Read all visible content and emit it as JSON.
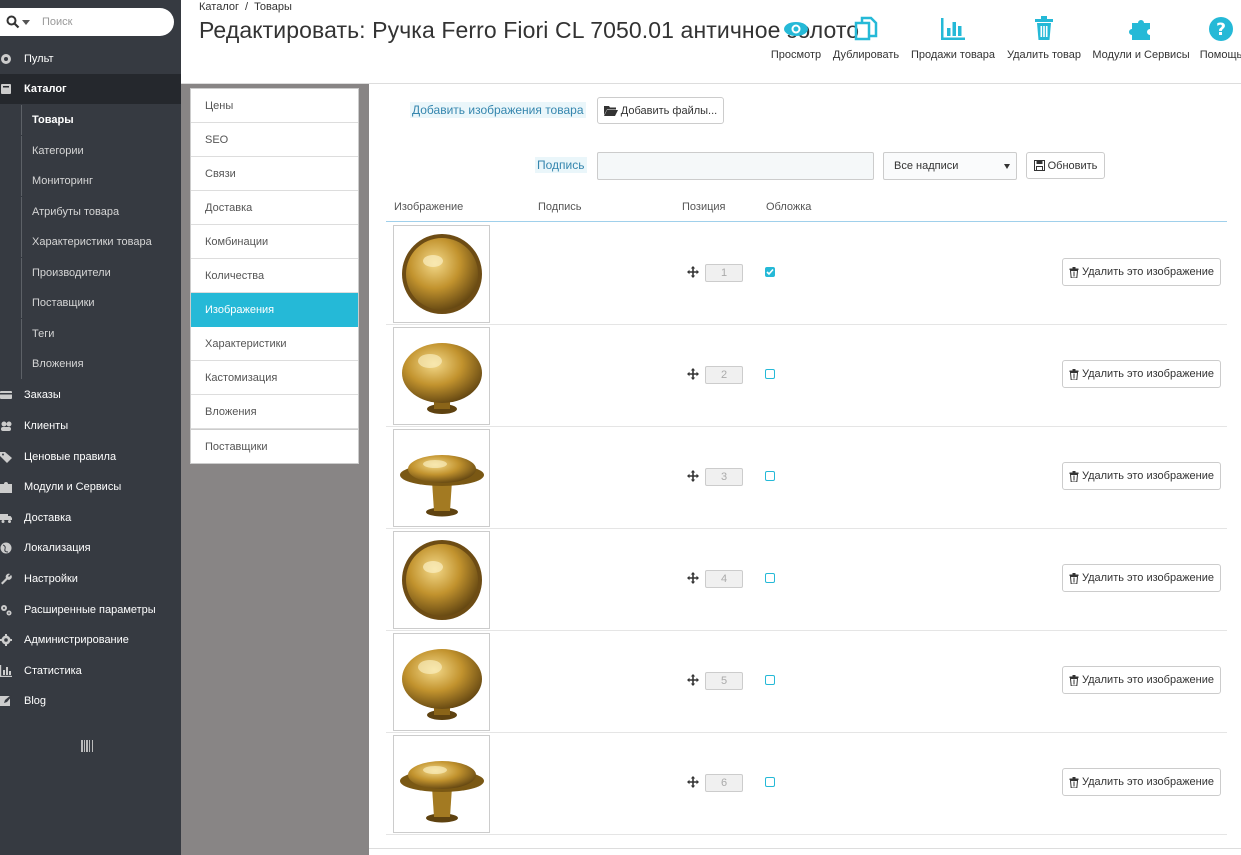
{
  "search": {
    "placeholder": "Поиск"
  },
  "sidebar": {
    "items": [
      {
        "label": "Пульт",
        "icon": "dashboard-icon"
      },
      {
        "label": "Каталог",
        "icon": "catalog-icon",
        "active": true
      },
      {
        "label": "Заказы",
        "icon": "orders-icon"
      },
      {
        "label": "Клиенты",
        "icon": "customers-icon"
      },
      {
        "label": "Ценовые правила",
        "icon": "tag-icon"
      },
      {
        "label": "Модули и Сервисы",
        "icon": "puzzle-icon"
      },
      {
        "label": "Доставка",
        "icon": "truck-icon"
      },
      {
        "label": "Локализация",
        "icon": "globe-icon"
      },
      {
        "label": "Настройки",
        "icon": "wrench-icon"
      },
      {
        "label": "Расширенные параметры",
        "icon": "cogs-icon"
      },
      {
        "label": "Администрирование",
        "icon": "gear-icon"
      },
      {
        "label": "Статистика",
        "icon": "bar-chart-icon"
      },
      {
        "label": "Blog",
        "icon": "edit-icon"
      }
    ],
    "catalog_sub": [
      {
        "label": "Товары",
        "active": true
      },
      {
        "label": "Категории"
      },
      {
        "label": "Мониторинг"
      },
      {
        "label": "Атрибуты товара"
      },
      {
        "label": "Характеристики товара"
      },
      {
        "label": "Производители"
      },
      {
        "label": "Поставщики"
      },
      {
        "label": "Теги"
      },
      {
        "label": "Вложения"
      }
    ]
  },
  "header": {
    "breadcrumb": [
      "Каталог",
      "Товары"
    ],
    "breadcrumb_sep": "/",
    "title": "Редактировать: Ручка Ferro Fiori CL 7050.01 античное золото",
    "toolbar": [
      {
        "label": "Просмотр",
        "icon": "eye-icon"
      },
      {
        "label": "Дублировать",
        "icon": "copy-icon"
      },
      {
        "label": "Продажи товара",
        "icon": "bar-chart-icon"
      },
      {
        "label": "Удалить товар",
        "icon": "trash-icon"
      },
      {
        "label": "Модули и Сервисы",
        "icon": "puzzle-icon"
      },
      {
        "label": "Помощь",
        "icon": "help-icon"
      }
    ],
    "accent_color": "#25b9d7"
  },
  "tabs": [
    {
      "label": "Цены"
    },
    {
      "label": "SEO"
    },
    {
      "label": "Связи"
    },
    {
      "label": "Доставка"
    },
    {
      "label": "Комбинации"
    },
    {
      "label": "Количества"
    },
    {
      "label": "Изображения",
      "active": true
    },
    {
      "label": "Характеристики"
    },
    {
      "label": "Кастомизация"
    },
    {
      "label": "Вложения"
    },
    {
      "label": "Поставщики"
    }
  ],
  "images_panel": {
    "add_images_label": "Добавить изображения товара",
    "add_files_button": "Добавить файлы...",
    "caption_label": "Подпись",
    "caption_value": "",
    "lang_select": "Все надписи",
    "update_button": "Обновить",
    "columns": [
      "Изображение",
      "Подпись",
      "Позиция",
      "Обложка"
    ],
    "rows": [
      {
        "position": "1",
        "cover": true,
        "view": "top",
        "delete_label": "Удалить это изображение"
      },
      {
        "position": "2",
        "cover": false,
        "view": "angle",
        "delete_label": "Удалить это изображение"
      },
      {
        "position": "3",
        "cover": false,
        "view": "side",
        "delete_label": "Удалить это изображение"
      },
      {
        "position": "4",
        "cover": false,
        "view": "top",
        "delete_label": "Удалить это изображение"
      },
      {
        "position": "5",
        "cover": false,
        "view": "angle",
        "delete_label": "Удалить это изображение"
      },
      {
        "position": "6",
        "cover": false,
        "view": "side",
        "delete_label": "Удалить это изображение"
      }
    ]
  }
}
